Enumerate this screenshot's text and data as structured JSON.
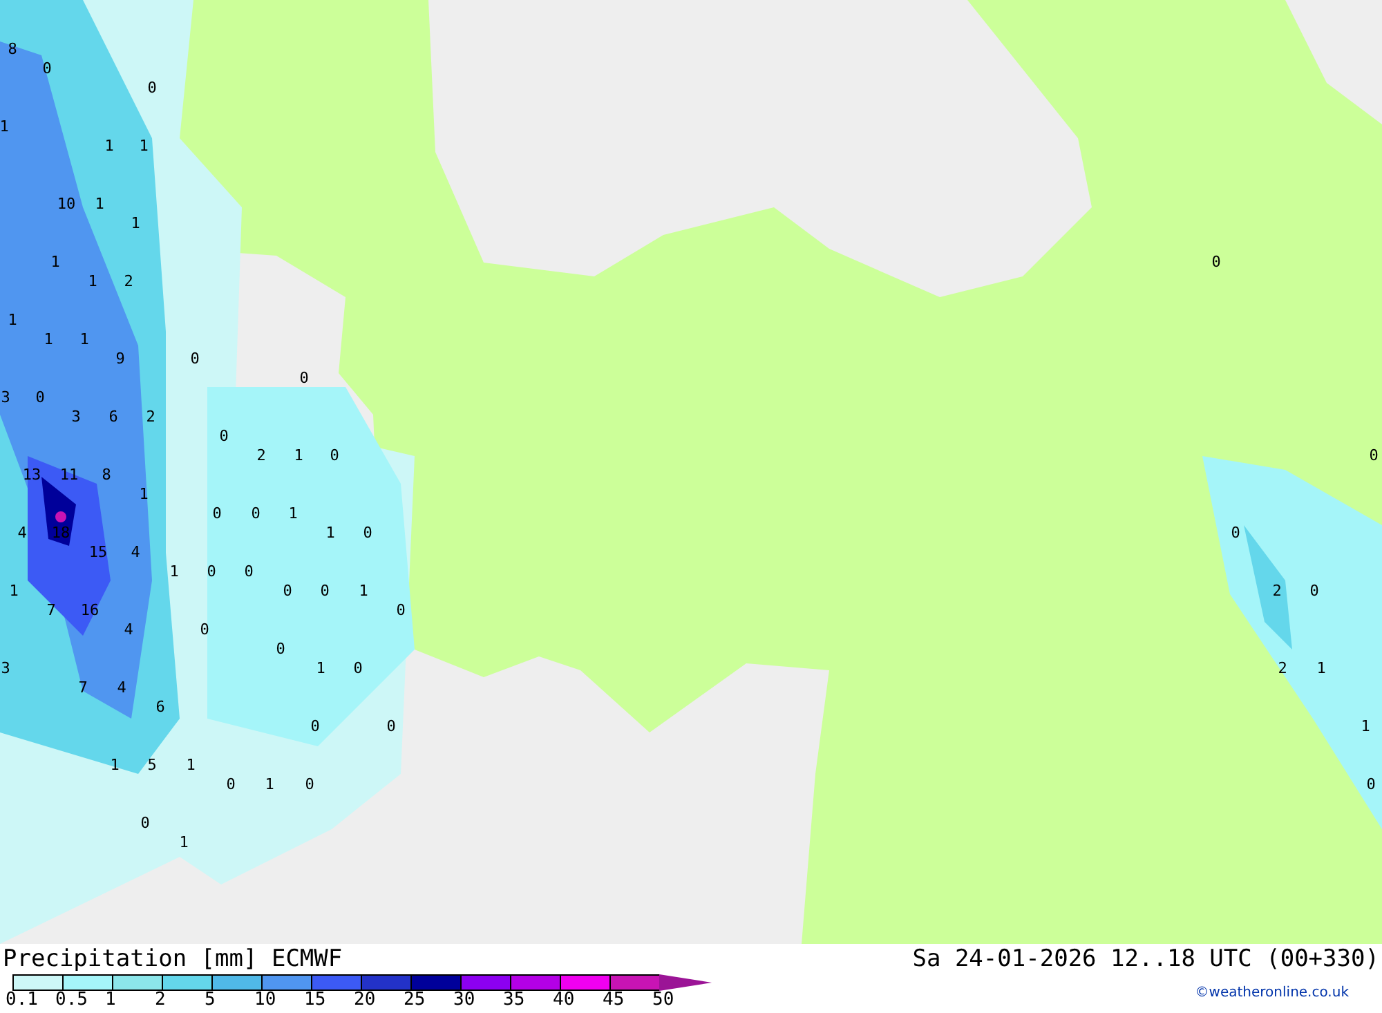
{
  "map": {
    "value_labels": [
      "8",
      "0",
      "0",
      "1",
      "1",
      "1",
      "10",
      "1",
      "1",
      "1",
      "0",
      "1",
      "2",
      "1",
      "1",
      "1",
      "9",
      "0",
      "0",
      "3",
      "0",
      "3",
      "6",
      "2",
      "0",
      "2",
      "1",
      "0",
      "0",
      "13",
      "11",
      "8",
      "1",
      "0",
      "0",
      "1",
      "4",
      "18",
      "1",
      "0",
      "0",
      "15",
      "4",
      "1",
      "0",
      "0",
      "1",
      "0",
      "0",
      "1",
      "2",
      "0",
      "7",
      "16",
      "0",
      "4",
      "0",
      "0",
      "3",
      "1",
      "0",
      "2",
      "1",
      "7",
      "4",
      "6",
      "0",
      "0",
      "1",
      "1",
      "5",
      "1",
      "0",
      "1",
      "0",
      "0",
      "0",
      "1"
    ]
  },
  "footer": {
    "title": "Precipitation [mm] ECMWF",
    "date": "Sa 24-01-2026 12..18 UTC (00+330)",
    "credit": "©weatheronline.co.uk"
  },
  "legend": {
    "segments": [
      {
        "color": "#cdf7f7"
      },
      {
        "color": "#a5f5f9"
      },
      {
        "color": "#8ce6ea"
      },
      {
        "color": "#64d7eb"
      },
      {
        "color": "#50b9e8"
      },
      {
        "color": "#5096f0"
      },
      {
        "color": "#3c5af5"
      },
      {
        "color": "#2332c8"
      },
      {
        "color": "#00009a"
      },
      {
        "color": "#8c00f0"
      },
      {
        "color": "#b400e6"
      },
      {
        "color": "#f000f0"
      },
      {
        "color": "#c814b4"
      }
    ],
    "ticks": [
      "0.1",
      "0.5",
      "1",
      "2",
      "5",
      "10",
      "15",
      "20",
      "25",
      "30",
      "35",
      "40",
      "45",
      "50"
    ]
  }
}
